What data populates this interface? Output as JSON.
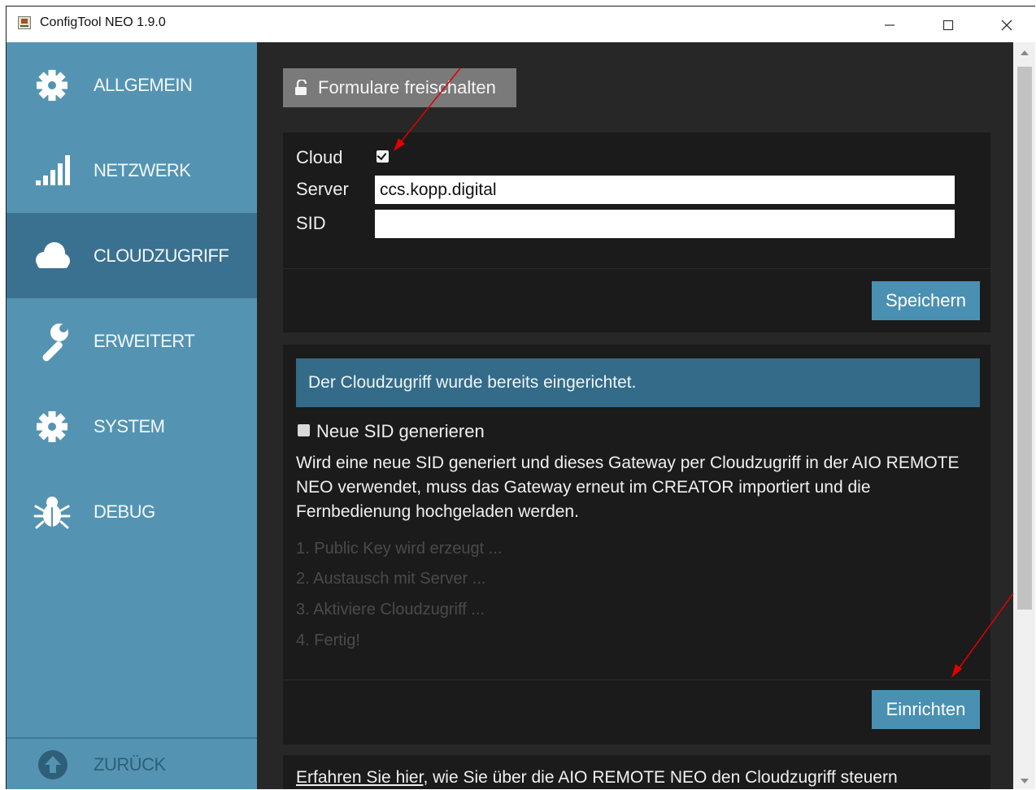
{
  "window": {
    "title": "ConfigTool NEO 1.9.0"
  },
  "sidebar": {
    "items": [
      {
        "label": "ALLGEMEIN",
        "icon": "gear-icon"
      },
      {
        "label": "NETZWERK",
        "icon": "signal-bars-icon"
      },
      {
        "label": "CLOUDZUGRIFF",
        "icon": "cloud-icon",
        "active": true
      },
      {
        "label": "ERWEITERT",
        "icon": "wrench-icon"
      },
      {
        "label": "SYSTEM",
        "icon": "gear-icon"
      },
      {
        "label": "DEBUG",
        "icon": "bug-icon"
      }
    ],
    "back_label": "ZURÜCK"
  },
  "toolbar": {
    "unlock_label": "Formulare freischalten"
  },
  "cloud_form": {
    "cloud_label": "Cloud",
    "cloud_checked": true,
    "server_label": "Server",
    "server_value": "ccs.kopp.digital",
    "sid_label": "SID",
    "sid_value": "",
    "save_label": "Speichern"
  },
  "setup": {
    "alert": "Der Cloudzugriff wurde bereits eingerichtet.",
    "new_sid_label": "Neue SID generieren",
    "new_sid_checked": false,
    "description": "Wird eine neue SID generiert und dieses Gateway per Cloudzugriff in der AIO REMOTE NEO verwendet, muss das Gateway erneut im CREATOR importiert und die Fernbedienung hochgeladen werden.",
    "steps": [
      "1. Public Key wird erzeugt ...",
      "2. Austausch mit Server ...",
      "3. Aktiviere Cloudzugriff ...",
      "4. Fertig!"
    ],
    "setup_label": "Einrichten"
  },
  "info": {
    "link_text": "Erfahren Sie hier",
    "text": ", wie Sie über die AIO REMOTE NEO den Cloudzugriff steuern"
  },
  "colors": {
    "sidebar": "#5494b2",
    "sidebar_active": "#3b7190",
    "content_bg": "#272727",
    "panel_bg": "#1b1b1b",
    "accent_button": "#4a90b2",
    "alert_bg": "#336b88",
    "annotation_arrow": "#e00000"
  }
}
